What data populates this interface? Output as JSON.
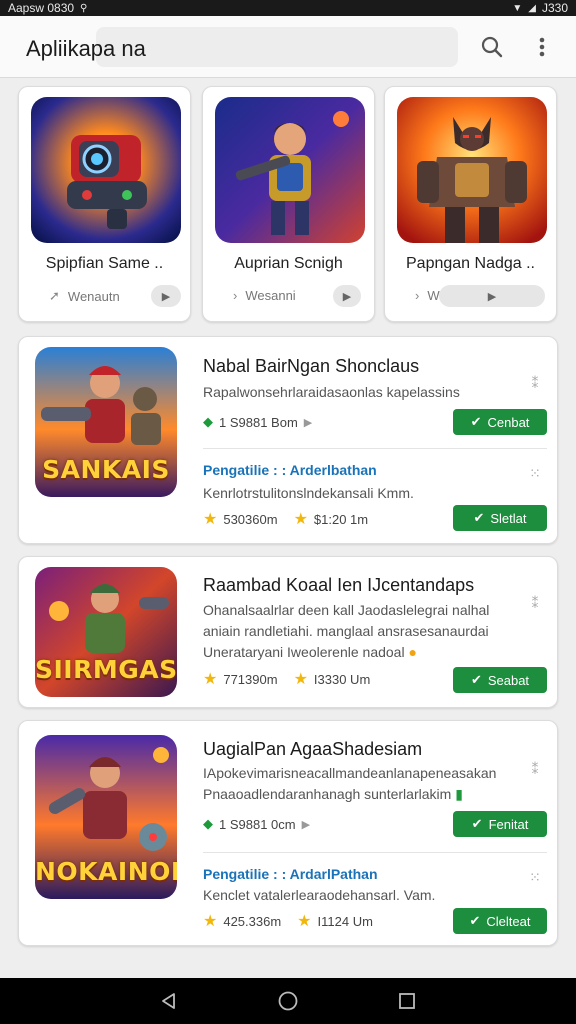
{
  "status_bar": {
    "left_text": "Aapsw  0830",
    "right_text": "J330"
  },
  "app_bar": {
    "title": "Apliikapa na"
  },
  "featured": [
    {
      "title": "Spipfian Same ..",
      "subtitle": "Wenautn"
    },
    {
      "title": "Auprian Scnigh",
      "subtitle": "Wesanni"
    },
    {
      "title": "Papngan Nadga ..",
      "subtitle": "Wrasiun"
    }
  ],
  "cards": [
    {
      "title": "Nabal BairNgan Shonclaus",
      "desc": "Rapalwonsehrlaraidasaonlas kapelassins",
      "stat1": "1 S9881 Bom",
      "btn1": "Cenbat",
      "link": "Pengatilie : : Arderlbathan",
      "note": "Kenrlotrstulitonslndekansali Kmm.",
      "rating": "530360m",
      "count": "$1:20 1m",
      "btn2": "Sletlat",
      "logo": "SANKAIS"
    },
    {
      "title": "Raambad Koaal  Ien IJcentandaps",
      "desc1": "Ohanalsaalrlar deen kall Jaodaslelegrai nalhal",
      "desc2": "aniain randletiahi. manglaal ansrasesanaurdai",
      "desc3": "Unerataryani Iweolerenle nadoal",
      "rating": "771390m",
      "count": "I3330 Um",
      "btn": "Seabat",
      "logo": "SIIRMGAS"
    },
    {
      "title": "UagialPan AgaaShadesiam",
      "desc1": "IApokevimarisneacallmandeanlanapeneasakan",
      "desc2": "Pnaaoadlendaranhanagh sunterlarlakim",
      "stat1": "1 S9881 0cm",
      "btn1": "Fenitat",
      "link": "Pengatilie : : ArdarlPathan",
      "note": "Kenclet vatalerlearaodehansarl. Vam.",
      "rating": "425.336m",
      "count": "I1124 Um",
      "btn2": "Clelteat",
      "logo": "NOKAINON"
    }
  ],
  "colors": {
    "accent_green": "#1d8d3e",
    "link_blue": "#1a73b8",
    "star": "#f2b70c"
  },
  "icons": [
    "search-icon",
    "more-vert-icon",
    "back-icon",
    "home-icon",
    "recents-icon",
    "star-icon",
    "check-icon",
    "play-icon"
  ]
}
